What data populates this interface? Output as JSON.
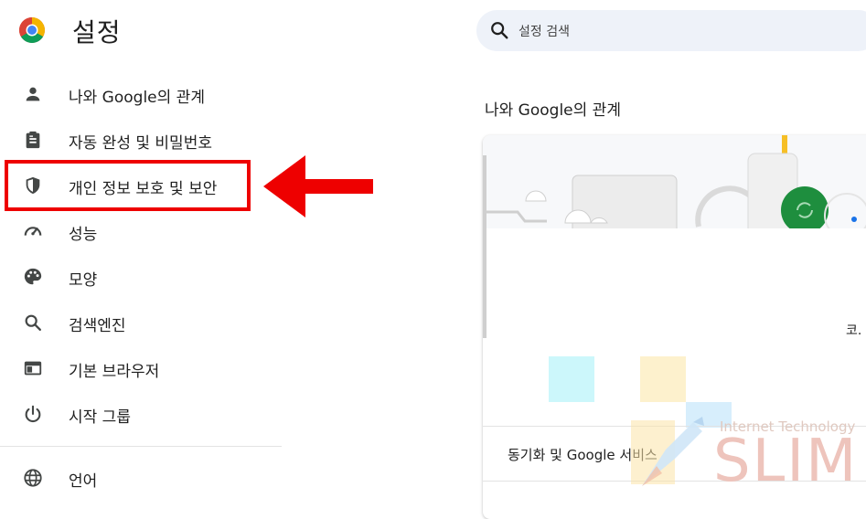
{
  "header": {
    "title": "설정",
    "logo": "chrome-logo"
  },
  "search": {
    "placeholder": "설정 검색",
    "icon": "search-icon"
  },
  "sidebar": {
    "items": [
      {
        "label": "나와 Google의 관계",
        "icon": "person-icon"
      },
      {
        "label": "자동 완성 및 비밀번호",
        "icon": "clipboard-icon"
      },
      {
        "label": "개인 정보 보호 및 보안",
        "icon": "shield-icon",
        "highlighted": true
      },
      {
        "label": "성능",
        "icon": "speedometer-icon"
      },
      {
        "label": "모양",
        "icon": "palette-icon"
      },
      {
        "label": "검색엔진",
        "icon": "search-icon"
      },
      {
        "label": "기본 브라우저",
        "icon": "browser-icon"
      },
      {
        "label": "시작 그룹",
        "icon": "power-icon"
      },
      {
        "label": "언어",
        "icon": "globe-icon"
      }
    ]
  },
  "main": {
    "section_title": "나와 Google의 관계",
    "card": {
      "text_fragment": "코.",
      "sync_row_label": "동기화 및 Google 서비스"
    }
  },
  "annotation": {
    "box_color": "#ee0000",
    "arrow_color": "#ee0000"
  },
  "watermark": {
    "small_text": "Internet Technology",
    "big_text": "SLIM"
  },
  "colors": {
    "search_bg": "#eef2f9",
    "icon": "#444746",
    "accent_green": "#1e8e3e",
    "accent_yellow": "#f6bf26"
  }
}
